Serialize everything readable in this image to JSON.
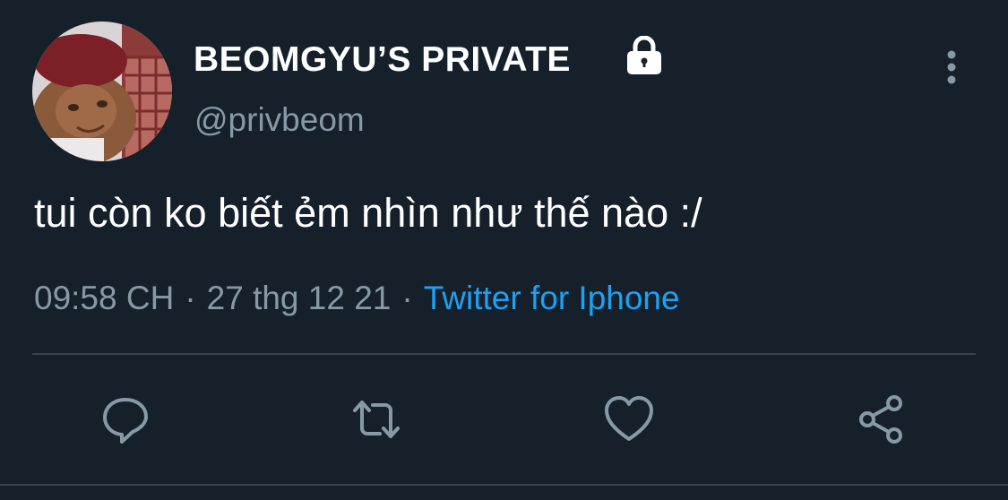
{
  "tweet": {
    "author": {
      "display_name": "BEOMGYU’S PRIVATE",
      "handle": "@privbeom",
      "protected_icon": "lock-icon",
      "avatar": "avatar-photo"
    },
    "text": "tui còn ko biết ẻm nhìn như thế nào :/",
    "time": "09:58 CH",
    "date": "27 thg 12 21",
    "separator": "·",
    "source": "Twitter for Iphone",
    "more_icon": "more-vertical-icon"
  },
  "actions": [
    {
      "name": "reply",
      "icon": "comment-icon"
    },
    {
      "name": "retweet",
      "icon": "retweet-icon"
    },
    {
      "name": "like",
      "icon": "heart-icon"
    },
    {
      "name": "share",
      "icon": "share-icon"
    }
  ],
  "colors": {
    "background": "#15202b",
    "text": "#ffffff",
    "secondary": "#8899a6",
    "link": "#1da1f2",
    "divider": "#38444d"
  }
}
